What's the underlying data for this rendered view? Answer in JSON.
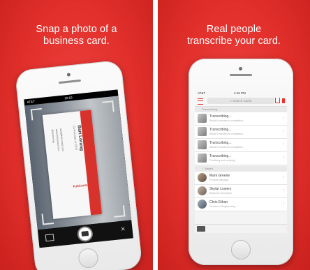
{
  "left_panel": {
    "caption_line1": "Snap a photo of a",
    "caption_line2": "business card.",
    "status_carrier": "AT&T",
    "status_time": "10:19",
    "card": {
      "name": "Bart Lorang",
      "role": "Co-Founder & CEO",
      "brand": "FullContact",
      "lines": [
        "bart@fullcontact.com",
        "www.fullcontact.com",
        "@bartlorang"
      ]
    },
    "toolbar_icons": [
      "gallery-icon",
      "camera-icon",
      "close-icon"
    ]
  },
  "right_panel": {
    "caption_line1": "Real people",
    "caption_line2": "transcribe your card.",
    "status_carrier": "AT&T",
    "status_time": "4:16 PM",
    "search_placeholder": "Search Cards",
    "section_pending": "Transcribing...",
    "section_added": "Added",
    "pending_rows": [
      {
        "title": "Transcribing...",
        "sub": "About 6 minutes to completion"
      },
      {
        "title": "Transcribing...",
        "sub": "About 9 minutes to completion"
      },
      {
        "title": "Transcribing...",
        "sub": "About 9 minutes to completion"
      },
      {
        "title": "Transcribing...",
        "sub": "Finalizing and verifying"
      }
    ],
    "contact_rows": [
      {
        "title": "Mark Greene",
        "sub": "Product Manager"
      },
      {
        "title": "Skylar Lowery",
        "sub": "Business Developer"
      },
      {
        "title": "Chris Ethan",
        "sub": "Director of Engineering"
      }
    ],
    "colors": {
      "accent": "#e8332e"
    }
  }
}
